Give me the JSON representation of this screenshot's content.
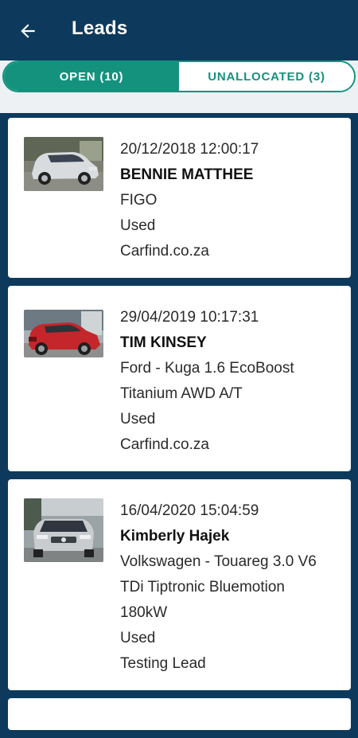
{
  "header": {
    "title": "Leads",
    "back_icon": "arrow-left-icon"
  },
  "tabs": [
    {
      "label": "OPEN (10)",
      "active": true
    },
    {
      "label": "UNALLOCATED (3)",
      "active": false
    }
  ],
  "colors": {
    "primary": "#0d3a5c",
    "accent": "#14927e"
  },
  "leads": [
    {
      "date": "20/12/2018 12:00:17",
      "name": "BENNIE MATTHEE",
      "vehicle_lines": [
        "FIGO"
      ],
      "condition": "Used",
      "source": "Carfind.co.za",
      "image": "silver-hatchback-photo"
    },
    {
      "date": "29/04/2019 10:17:31",
      "name": "TIM KINSEY",
      "vehicle_lines": [
        "Ford - Kuga 1.6 EcoBoost",
        "Titanium AWD A/T"
      ],
      "condition": "Used",
      "source": "Carfind.co.za",
      "image": "red-suv-photo"
    },
    {
      "date": "16/04/2020 15:04:59",
      "name": "Kimberly Hajek",
      "vehicle_lines": [
        "Volkswagen - Touareg 3.0 V6",
        "TDi Tiptronic Bluemotion",
        "180kW"
      ],
      "condition": "Used",
      "source": "Testing Lead",
      "image": "silver-suv-photo"
    }
  ]
}
